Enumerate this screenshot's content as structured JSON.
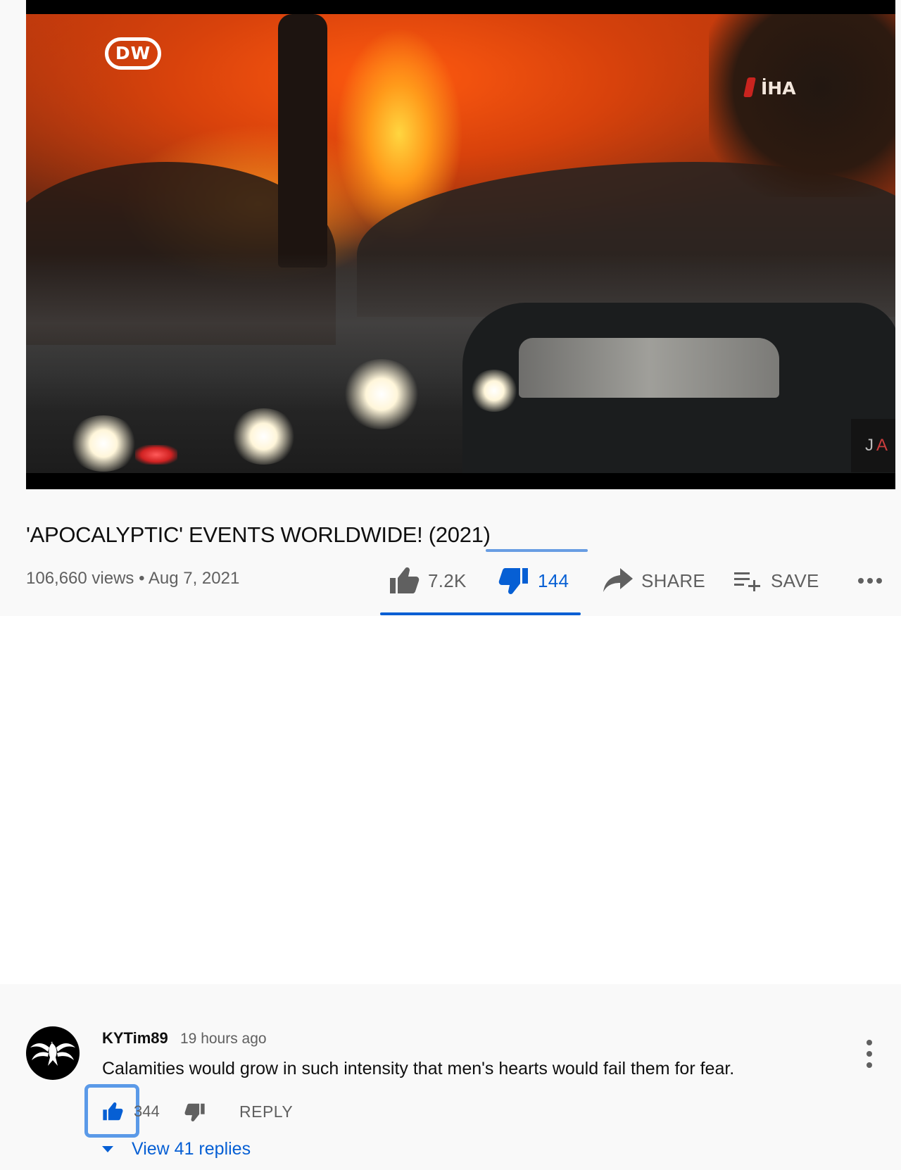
{
  "video": {
    "channel_logo": "DW",
    "watermark": "İHA",
    "corner_badge": {
      "left": "J",
      "right": "A"
    },
    "title": "'APOCALYPTIC' EVENTS WORLDWIDE! (2021)",
    "meta": "106,660 views • Aug 7, 2021"
  },
  "actions": {
    "like_count": "7.2K",
    "dislike_count": "144",
    "share_label": "SHARE",
    "save_label": "SAVE",
    "like_icon": "thumb-up-outline-icon",
    "dislike_icon": "thumb-down-filled-icon",
    "share_icon": "share-arrow-icon",
    "save_icon": "playlist-add-icon",
    "more_icon": "more-horizontal-icon"
  },
  "comment": {
    "author": "KYTim89",
    "time": "19 hours ago",
    "text": "Calamities would grow in such intensity that men's hearts would fail them for fear.",
    "like_count": "344",
    "reply_label": "REPLY",
    "view_replies": "View 41 replies",
    "avatar_icon": "spider-emblem-icon",
    "menu_icon": "more-vertical-icon"
  },
  "colors": {
    "accent": "#065fd4",
    "text_primary": "#0f0f0f",
    "text_secondary": "#606060",
    "panel_bg": "#f9f9f9",
    "highlight_border": "#5b9ae8"
  }
}
